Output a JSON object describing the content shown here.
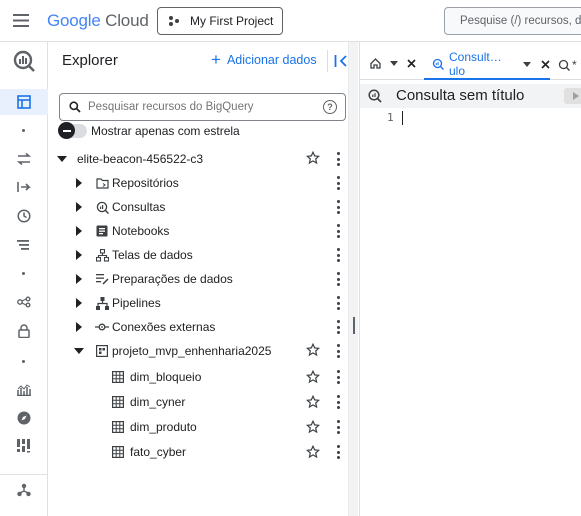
{
  "topbar": {
    "brand_google": "Google",
    "brand_cloud": "Cloud",
    "project_button": "My First Project",
    "search_placeholder": "Pesquise (/) recursos, do"
  },
  "rail": {
    "icons": [
      "bigquery-logo-icon",
      "explorer-icon",
      "transfers-icon",
      "scheduled-queries-icon",
      "history-icon",
      "jobs-icon",
      "connections-icon",
      "security-icon",
      "monitoring-icon",
      "discover-icon",
      "data-apps-icon",
      "pipelines-icon"
    ]
  },
  "explorer": {
    "title": "Explorer",
    "add_data": "Adicionar dados",
    "search_placeholder": "Pesquisar recursos do BigQuery",
    "toggle_label": "Mostrar apenas com estrela",
    "project": "elite-beacon-456522-c3",
    "items": [
      {
        "label": "Repositórios",
        "icon": "repository-icon"
      },
      {
        "label": "Consultas",
        "icon": "queries-icon"
      },
      {
        "label": "Notebooks",
        "icon": "notebook-icon"
      },
      {
        "label": "Telas de dados",
        "icon": "data-canvas-icon"
      },
      {
        "label": "Preparações de dados",
        "icon": "data-preparation-icon"
      },
      {
        "label": "Pipelines",
        "icon": "pipelines-icon"
      },
      {
        "label": "Conexões externas",
        "icon": "external-connections-icon"
      }
    ],
    "dataset": "projeto_mvp_enhenharia2025",
    "tables": [
      "dim_bloqueio",
      "dim_cyner",
      "dim_produto",
      "fato_cyber"
    ]
  },
  "editor": {
    "tab_active": "Consult…ulo",
    "tab_next": "*",
    "query_title": "Consulta sem título",
    "line_number": "1"
  }
}
